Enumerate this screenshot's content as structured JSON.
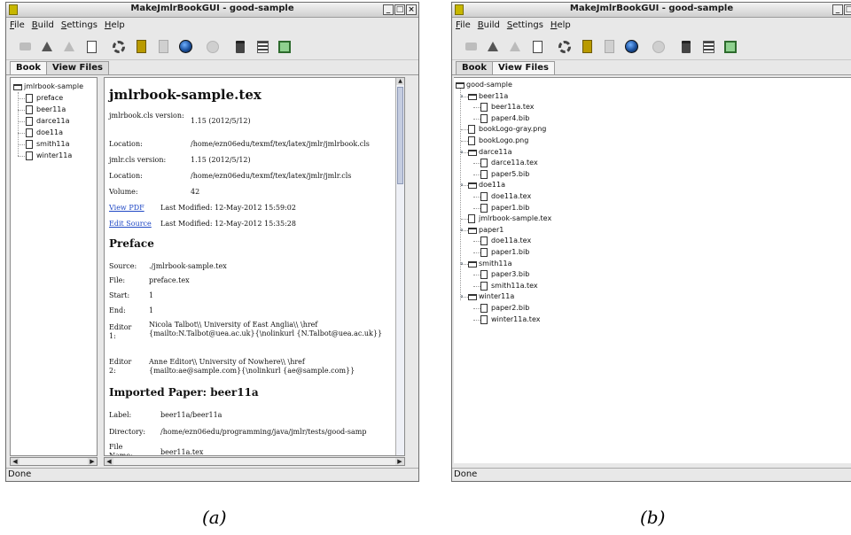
{
  "window_a": {
    "title": "MakeJmlrBookGUI - good-sample",
    "menu": [
      "File",
      "Build",
      "Settings",
      "Help"
    ],
    "tabs": [
      "Book",
      "View Files"
    ],
    "active_tab": "Book",
    "tree": {
      "root": "jmlrbook-sample",
      "items": [
        "preface",
        "beer11a",
        "darce11a",
        "doe11a",
        "smith11a",
        "winter11a"
      ]
    },
    "content": {
      "heading": "jmlrbook-sample.tex",
      "meta": [
        {
          "key": "jmlrbook.cls version:",
          "value": "1.15 (2012/5/12)"
        },
        {
          "key": "Location:",
          "value": "/home/ezn06edu/texmf/tex/latex/jmlr/jmlrbook.cls"
        },
        {
          "key": "jmlr.cls version:",
          "value": "1.15 (2012/5/12)"
        },
        {
          "key": "Location:",
          "value": "/home/ezn06edu/texmf/tex/latex/jmlr/jmlr.cls"
        },
        {
          "key": "Volume:",
          "value": "42"
        }
      ],
      "view_pdf": {
        "link": "View PDF",
        "text": "Last Modified: 12-May-2012 15:59:02"
      },
      "edit_source": {
        "link": "Edit Source",
        "text": "Last Modified: 12-May-2012 15:35:28"
      },
      "preface_heading": "Preface",
      "preface": [
        {
          "key": "Source:",
          "value": "./jmlrbook-sample.tex"
        },
        {
          "key": "File:",
          "value": "preface.tex"
        },
        {
          "key": "Start:",
          "value": "1"
        },
        {
          "key": "End:",
          "value": "1"
        },
        {
          "key": "Editor 1:",
          "value": "Nicola Talbot\\\\ University of East Anglia\\\\ \\href {mailto:N.Talbot@uea.ac.uk}{\\nolinkurl {N.Talbot@uea.ac.uk}}"
        },
        {
          "key": "Editor 2:",
          "value": "Anne Editor\\\\ University of Nowhere\\\\ \\href {mailto:ae@sample.com}{\\nolinkurl {ae@sample.com}}"
        }
      ],
      "imported_heading": "Imported Paper: beer11a",
      "imported": [
        {
          "key": "Label:",
          "value": "beer11a/beer11a"
        },
        {
          "key": "Directory:",
          "value": "/home/ezn06edu/programming/java/jmlr/tests/good-samp"
        },
        {
          "key": "File Name:",
          "value": "beer11a.tex"
        }
      ]
    },
    "status": "Done"
  },
  "window_b": {
    "title": "MakeJmlrBookGUI - good-sample",
    "menu": [
      "File",
      "Build",
      "Settings",
      "Help"
    ],
    "tabs": [
      "Book",
      "View Files"
    ],
    "active_tab": "View Files",
    "tree": [
      {
        "label": "good-sample",
        "type": "folder",
        "depth": 0
      },
      {
        "label": "beer11a",
        "type": "folder",
        "depth": 1
      },
      {
        "label": "beer11a.tex",
        "type": "file",
        "depth": 2
      },
      {
        "label": "paper4.bib",
        "type": "file",
        "depth": 2
      },
      {
        "label": "bookLogo-gray.png",
        "type": "file",
        "depth": 1
      },
      {
        "label": "bookLogo.png",
        "type": "file",
        "depth": 1
      },
      {
        "label": "darce11a",
        "type": "folder",
        "depth": 1
      },
      {
        "label": "darce11a.tex",
        "type": "file",
        "depth": 2
      },
      {
        "label": "paper5.bib",
        "type": "file",
        "depth": 2
      },
      {
        "label": "doe11a",
        "type": "folder",
        "depth": 1
      },
      {
        "label": "doe11a.tex",
        "type": "file",
        "depth": 2
      },
      {
        "label": "paper1.bib",
        "type": "file",
        "depth": 2
      },
      {
        "label": "jmlrbook-sample.tex",
        "type": "file",
        "depth": 1
      },
      {
        "label": "paper1",
        "type": "folder",
        "depth": 1
      },
      {
        "label": "doe11a.tex",
        "type": "file",
        "depth": 2
      },
      {
        "label": "paper1.bib",
        "type": "file",
        "depth": 2
      },
      {
        "label": "smith11a",
        "type": "folder",
        "depth": 1
      },
      {
        "label": "paper3.bib",
        "type": "file",
        "depth": 2
      },
      {
        "label": "smith11a.tex",
        "type": "file",
        "depth": 2
      },
      {
        "label": "winter11a",
        "type": "folder",
        "depth": 1
      },
      {
        "label": "paper2.bib",
        "type": "file",
        "depth": 2
      },
      {
        "label": "winter11a.tex",
        "type": "file",
        "depth": 2
      }
    ],
    "status": "Done"
  },
  "captions": {
    "a": "(a)",
    "b": "(b)"
  },
  "colors": {
    "link": "#1f48c5",
    "title_bar": "#d9d9d9",
    "app_icon": "#c7b700"
  }
}
